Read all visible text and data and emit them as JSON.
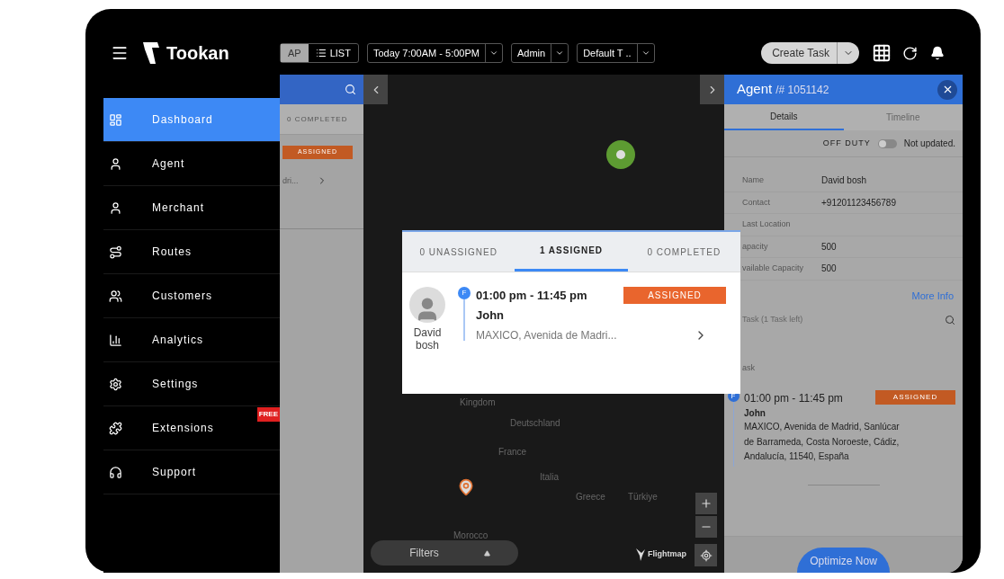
{
  "header": {
    "brand": "Tookan",
    "view_tabs": [
      {
        "label": "AP",
        "selected": true
      },
      {
        "label": "LIST",
        "selected": false
      }
    ],
    "filters": [
      "Today 7:00AM - 5:00PM",
      "Admin",
      "Default T .."
    ],
    "create_button": "Create Task"
  },
  "sidebar": {
    "items": [
      {
        "label": "Dashboard",
        "selected": true
      },
      {
        "label": "Agent",
        "selected": false
      },
      {
        "label": "Merchant",
        "selected": false
      },
      {
        "label": "Routes",
        "selected": false
      },
      {
        "label": "Customers",
        "selected": false
      },
      {
        "label": "Analytics",
        "selected": false
      },
      {
        "label": "Settings",
        "selected": false
      },
      {
        "label": "Extensions",
        "selected": false,
        "badge": "FREE"
      },
      {
        "label": "Support",
        "selected": false
      }
    ]
  },
  "task_list": {
    "tab": "0 COMPLETED",
    "task": {
      "status": "ASSIGNED",
      "address": "dri..."
    }
  },
  "map": {
    "labels": [
      "Kingdom",
      "Deutschland",
      "France",
      "Italia",
      "Greece",
      "Türkiye",
      "Morocco"
    ],
    "filters": "Filters",
    "brand": "Flightmap"
  },
  "popup": {
    "tabs": [
      {
        "label": "0 UNASSIGNED",
        "selected": false
      },
      {
        "label": "1 ASSIGNED",
        "selected": true
      },
      {
        "label": "0 COMPLETED",
        "selected": false
      }
    ],
    "task": {
      "agent": "David bosh",
      "marker": "F",
      "time": "01:00 pm - 11:45 pm",
      "customer": "John",
      "address": "MAXICO, Avenida de Madri...",
      "status": "ASSIGNED"
    }
  },
  "agent_panel": {
    "title": "Agent",
    "id": "/# 1051142",
    "tabs": [
      {
        "label": "Details",
        "selected": true
      },
      {
        "label": "Timeline",
        "selected": false
      }
    ],
    "duty_label": "OFF DUTY",
    "on_duty": false,
    "duty_status": "Not updated.",
    "fields": [
      {
        "label": "Name",
        "value": "David bosh"
      },
      {
        "label": "Contact",
        "value": "+91201123456789"
      },
      {
        "label": "Last Location"
      },
      {
        "label": "apacity",
        "value": "500"
      },
      {
        "label": "vailable Capacity",
        "value": "500"
      }
    ],
    "more_info": "More Info",
    "task_search": "Task (1 Task left)",
    "section": "ask",
    "task": {
      "marker": "F",
      "time": "01:00 pm - 11:45 pm",
      "customer": "John",
      "address": "MAXICO, Avenida de Madrid, Sanlúcar de Barrameda, Costa Noroeste, Cádiz, Andalucía, 11540, España",
      "status": "ASSIGNED"
    },
    "optimize_button": "Optimize Now"
  }
}
